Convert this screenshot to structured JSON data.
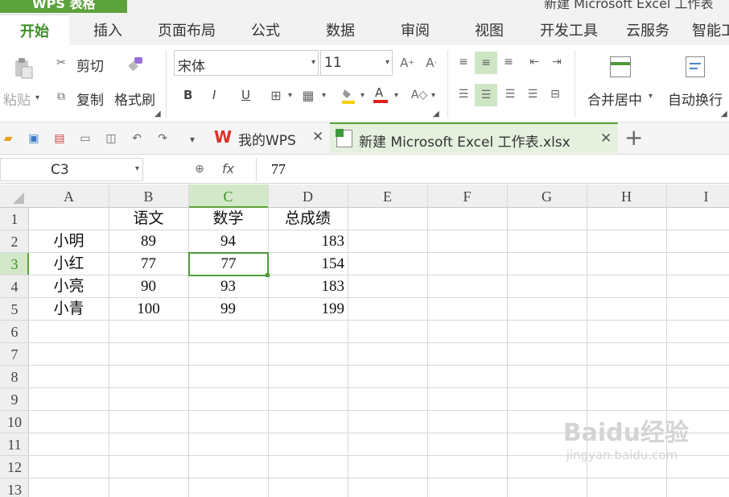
{
  "app": {
    "button_label": "WPS 表格",
    "window_title": "新建 Microsoft Excel 工作表"
  },
  "tabs": [
    "开始",
    "插入",
    "页面布局",
    "公式",
    "数据",
    "审阅",
    "视图",
    "开发工具",
    "云服务",
    "智能工"
  ],
  "ribbon": {
    "paste": "粘贴",
    "cut": "剪切",
    "copy": "复制",
    "format_painter": "格式刷",
    "font_name": "宋体",
    "font_size": "11",
    "bold": "B",
    "italic": "I",
    "underline": "U",
    "merge_center": "合并居中",
    "wrap_text": "自动换行"
  },
  "doc_tabs": [
    {
      "label": "我的WPS"
    },
    {
      "label": "新建 Microsoft Excel 工作表.xlsx"
    }
  ],
  "formula_bar": {
    "name_box": "C3",
    "fx": "fx",
    "value": "77"
  },
  "sheet": {
    "columns": [
      "A",
      "B",
      "C",
      "D",
      "E",
      "F",
      "G",
      "H",
      "I"
    ],
    "rows": [
      "1",
      "2",
      "3",
      "4",
      "5",
      "6",
      "7",
      "8",
      "9",
      "10",
      "11",
      "12",
      "13"
    ],
    "active_cell": "C3",
    "header_row": {
      "B": "语文",
      "C": "数学",
      "D": "总成绩"
    },
    "data": [
      {
        "A": "小明",
        "B": "89",
        "C": "94",
        "D": "183"
      },
      {
        "A": "小红",
        "B": "77",
        "C": "77",
        "D": "154"
      },
      {
        "A": "小亮",
        "B": "90",
        "C": "93",
        "D": "183"
      },
      {
        "A": "小青",
        "B": "100",
        "C": "99",
        "D": "199"
      }
    ]
  },
  "watermark": {
    "brand": "Baidu经验",
    "url": "jingyan.baidu.com"
  },
  "colors": {
    "accent": "#5ba33a",
    "selection": "#cfe6c4",
    "grid": "#d8d8d8"
  }
}
